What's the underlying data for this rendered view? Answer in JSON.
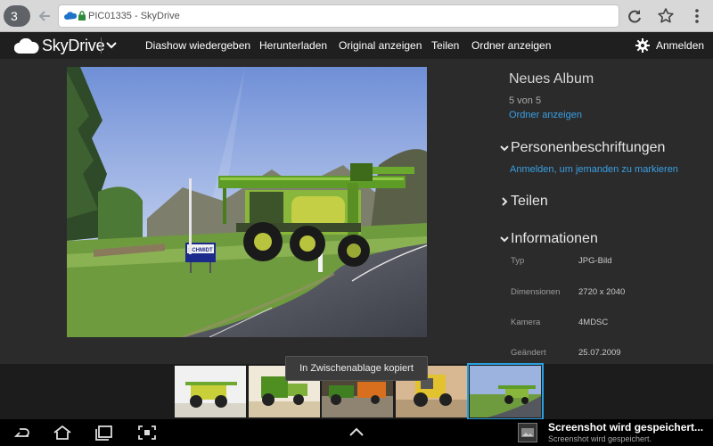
{
  "browser": {
    "tab_count": "3",
    "url_path": "PIC01335",
    "url_sep": " - ",
    "url_site": "SkyDrive"
  },
  "header": {
    "brand": "SkyDrive",
    "nav": [
      "Diashow wiedergeben",
      "Herunterladen",
      "Original anzeigen",
      "Teilen",
      "Ordner anzeigen"
    ],
    "signin": "Anmelden"
  },
  "info": {
    "album_title": "Neues Album",
    "album_count": "5 von 5",
    "album_link": "Ordner anzeigen",
    "sections": {
      "people": "Personenbeschriftungen",
      "people_link": "Anmelden, um jemanden zu markieren",
      "share": "Teilen",
      "information": "Informationen"
    },
    "props": [
      {
        "label": "Typ",
        "value": "JPG-Bild"
      },
      {
        "label": "Dimensionen",
        "value": "2720 x 2040"
      },
      {
        "label": "Kamera",
        "value": "4MDSC"
      },
      {
        "label": "Geändert",
        "value": "25.07.2009"
      }
    ]
  },
  "toast": "In Zwischenablage kopiert",
  "notification": {
    "title": "Screenshot wird gespeichert...",
    "subtitle": "Screenshot wird gespeichert."
  },
  "sign_text": "SCHMIDT",
  "colors": {
    "accent": "#2aa0e0",
    "link": "#3aa0e6",
    "header_bg": "#1f1f1f",
    "content_bg": "#2b2b2b"
  }
}
